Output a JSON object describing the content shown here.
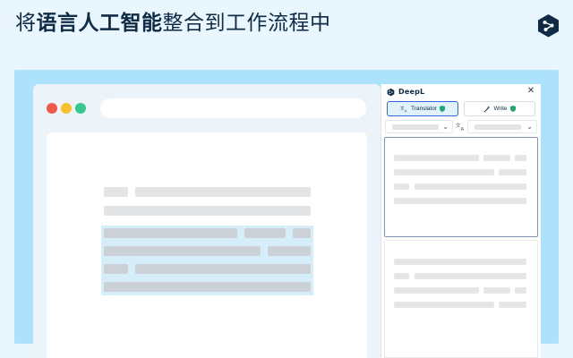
{
  "headline": {
    "prefix": "将",
    "highlight": "语言人工智能",
    "suffix": "整合到工作流程中"
  },
  "corner_logo": {
    "icon": "deepl-logo-icon",
    "color": "#0f2b46"
  },
  "browser": {
    "traffic_lights": [
      "#f15a4a",
      "#f6c12b",
      "#36c98e"
    ]
  },
  "extension_panel": {
    "app_name": "DeepL",
    "close_symbol": "✕",
    "tabs": [
      {
        "label": "Translator",
        "active": true
      },
      {
        "label": "Write",
        "active": false
      }
    ],
    "chevron": "⌄",
    "accent_color": "#2b6bdc",
    "verified_color": "#1ea672"
  }
}
